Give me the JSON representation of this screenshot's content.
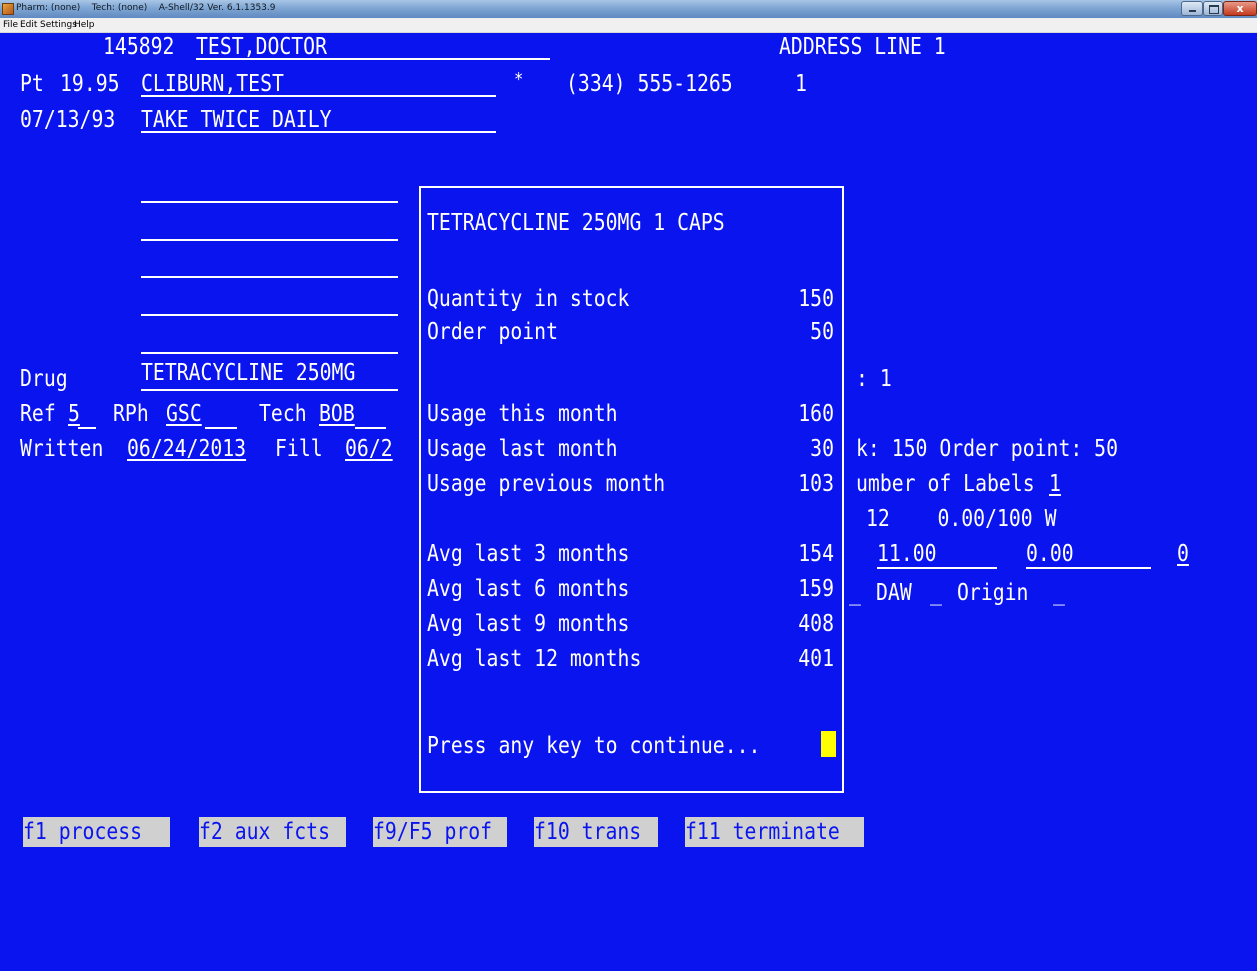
{
  "window": {
    "title": "Pharm: (none)    Tech: (none)    A-Shell/32 Ver. 6.1.1353.9",
    "close_glyph": "x",
    "menu": [
      "File",
      "Edit",
      "Settings",
      "Help"
    ]
  },
  "header": {
    "doctor_id": "145892",
    "doctor_name": "TEST,DOCTOR",
    "address": "ADDRESS LINE 1",
    "pt_label": "Pt",
    "pt_value": "19.95",
    "patient_name": "CLIBURN,TEST",
    "star": "*",
    "phone": "(334) 555-1265",
    "phone_suffix": "1",
    "sig_date": "07/13/93",
    "sig_text": "TAKE TWICE DAILY"
  },
  "form": {
    "drug_label": "Drug",
    "drug_value": "TETRACYCLINE 250MG",
    "ref_label": "Ref",
    "ref_value": "5",
    "rph_label": "RPh",
    "rph_value": "GSC",
    "tech_label": "Tech",
    "tech_value": "BOB",
    "written_label": "Written",
    "written_value": "06/24/2013",
    "fill_label": "Fill",
    "fill_value": "06/2"
  },
  "right_panel": {
    "line1": ": 1",
    "line2": "k: 150 Order point: 50",
    "labels_text": "umber of Labels",
    "labels_value": "1",
    "line4": "12    0.00/100 W",
    "price1": "11.00",
    "price2": "0.00",
    "price3": "0",
    "daw_prefix": "_",
    "daw_label": "DAW",
    "daw_value": "_",
    "origin_label": "Origin",
    "origin_value": "_"
  },
  "popup": {
    "title": "TETRACYCLINE 250MG 1 CAPS",
    "rows": [
      {
        "label": "Quantity in stock",
        "value": "150"
      },
      {
        "label": "Order point",
        "value": "50"
      },
      {
        "label": "Usage this month",
        "value": "160"
      },
      {
        "label": "Usage last month",
        "value": "30"
      },
      {
        "label": "Usage previous month",
        "value": "103"
      },
      {
        "label": "Avg last 3 months",
        "value": "154"
      },
      {
        "label": "Avg last 6 months",
        "value": "159"
      },
      {
        "label": "Avg last 9 months",
        "value": "408"
      },
      {
        "label": "Avg last 12 months",
        "value": "401"
      }
    ],
    "prompt": "Press any key to continue..."
  },
  "function_keys": [
    "f1 process",
    "f2 aux fcts",
    "f9/F5 prof",
    "f10 trans",
    "f11 terminate"
  ],
  "colors": {
    "background": "#0a14ee",
    "text": "#ffffff",
    "cursor": "#ffff00",
    "fkey_bg": "#d0d0d0"
  }
}
